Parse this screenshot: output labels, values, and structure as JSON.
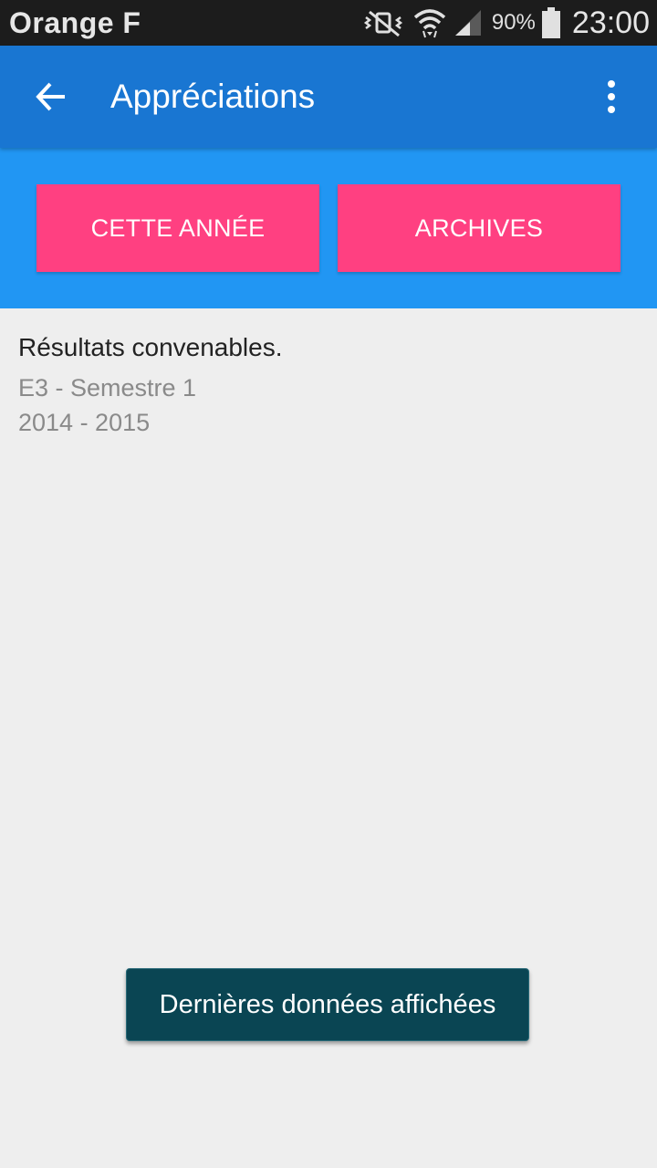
{
  "status_bar": {
    "carrier": "Orange F",
    "battery_percent": "90%",
    "time": "23:00",
    "icons": [
      "vibrate-mute-icon",
      "wifi-icon",
      "signal-icon",
      "battery-icon"
    ]
  },
  "app_bar": {
    "title": "Appréciations",
    "back_icon": "arrow-back-icon",
    "overflow_icon": "more-vert-icon"
  },
  "tabs": [
    {
      "label": "CETTE ANNÉE"
    },
    {
      "label": "ARCHIVES"
    }
  ],
  "entries": [
    {
      "title": "Résultats convenables.",
      "period": "E3 - Semestre 1",
      "year": "2014 - 2015"
    }
  ],
  "toast": {
    "message": "Dernières données affichées"
  },
  "colors": {
    "app_bar": "#1976d2",
    "tab_bar": "#2196f3",
    "accent": "#ff4081",
    "toast": "#0a4553",
    "background": "#eeeeee"
  }
}
